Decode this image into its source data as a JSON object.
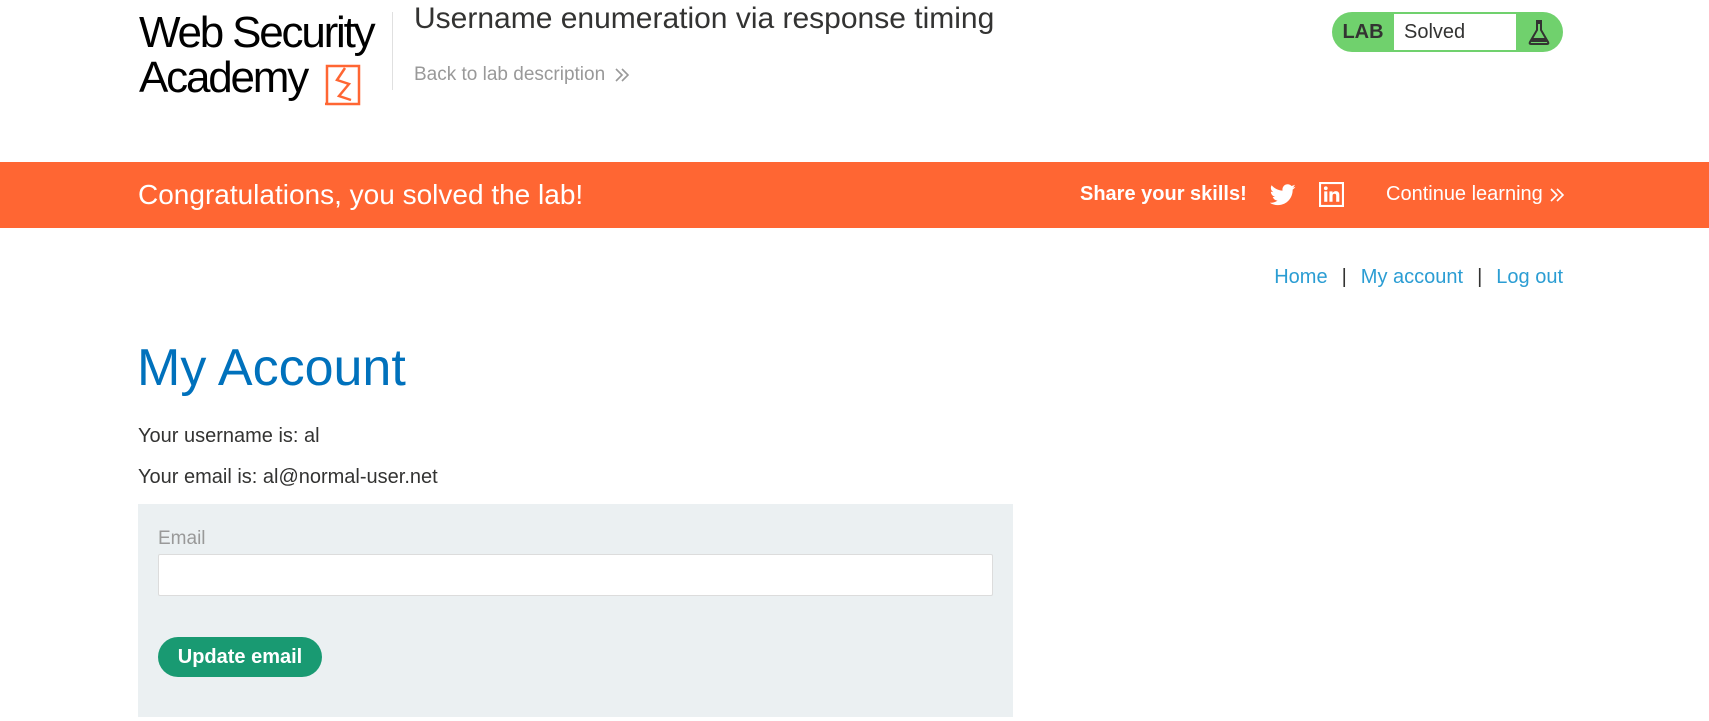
{
  "header": {
    "logo_line1": "Web Security",
    "logo_line2": "Academy",
    "lab_title": "Username enumeration via response timing",
    "back_link": "Back to lab description",
    "lab_status": {
      "tag": "LAB",
      "state": "Solved",
      "icon": "flask-icon",
      "color": "#70d16d"
    }
  },
  "banner": {
    "message": "Congratulations, you solved the lab!",
    "share_label": "Share your skills!",
    "share_icons": [
      "twitter-icon",
      "linkedin-icon"
    ],
    "continue_label": "Continue learning",
    "color": "#ff6633"
  },
  "nav": {
    "home": "Home",
    "separator": "|",
    "my_account": "My account",
    "log_out": "Log out"
  },
  "main": {
    "title": "My Account",
    "username_line": "Your username is: al",
    "email_line": "Your email is: al@normal-user.net",
    "form": {
      "email_label": "Email",
      "email_value": "",
      "email_placeholder": "",
      "submit_label": "Update email"
    }
  },
  "colors": {
    "link": "#2b9dd3",
    "title": "#0071bc",
    "button": "#199a72",
    "panel": "#ebf0f2"
  }
}
